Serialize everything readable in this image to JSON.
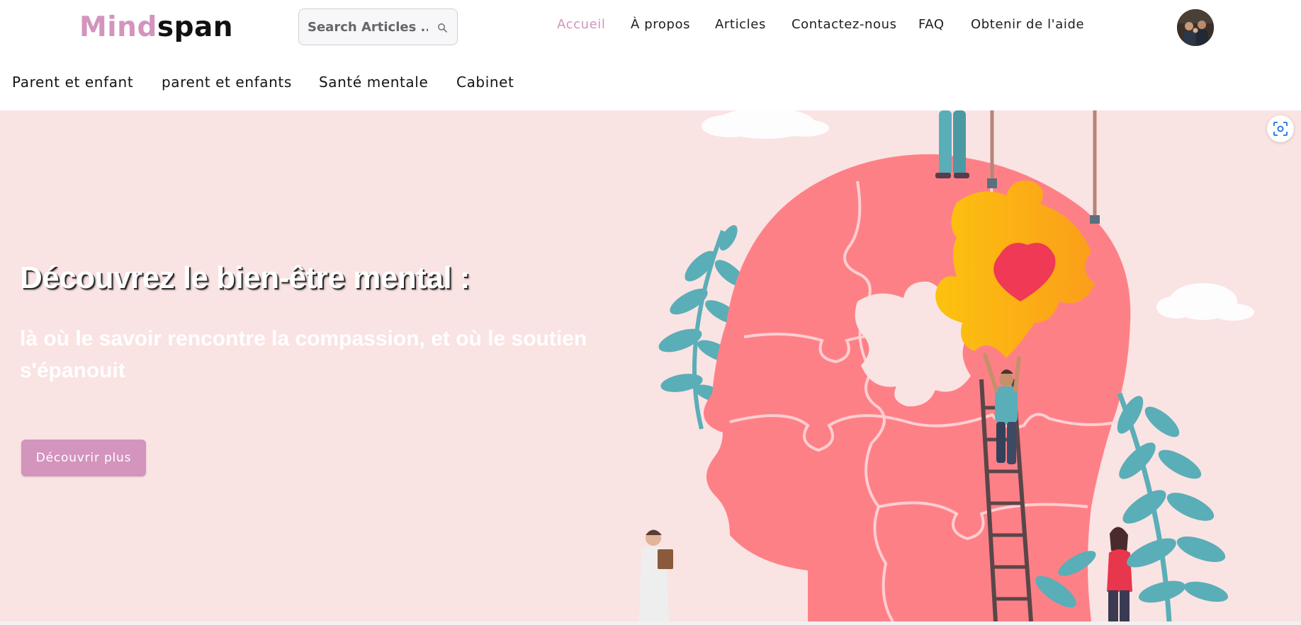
{
  "logo": {
    "part1": "Mind",
    "part2": "span"
  },
  "search": {
    "placeholder": "Search Articles ...",
    "icon": "search-icon"
  },
  "nav": {
    "items": [
      {
        "label": "Accueil",
        "active": true
      },
      {
        "label": "À propos",
        "active": false
      },
      {
        "label": "Articles",
        "active": false
      },
      {
        "label": "Contactez-nous",
        "active": false
      },
      {
        "label": "FAQ",
        "active": false
      },
      {
        "label": "Obtenir de l'aide",
        "active": false
      }
    ],
    "active_color": "#d394bd"
  },
  "categories": [
    {
      "label": "Parent et enfant"
    },
    {
      "label": "parent et enfants"
    },
    {
      "label": "Santé mentale"
    },
    {
      "label": "Cabinet"
    }
  ],
  "hero": {
    "title": "Découvrez le bien-être mental :",
    "subtitle": "là où le savoir rencontre la compassion, et où le soutien s'épanouit",
    "button_label": "Découvrir plus",
    "background_color": "#fae3e3",
    "illustration": "head-puzzle-illustration"
  },
  "colors": {
    "accent": "#d394bd",
    "hero_bg": "#fae3e3",
    "head": "#fe8087",
    "puzzle_piece": "#fbb91a",
    "leaf": "#5aaeb7"
  }
}
